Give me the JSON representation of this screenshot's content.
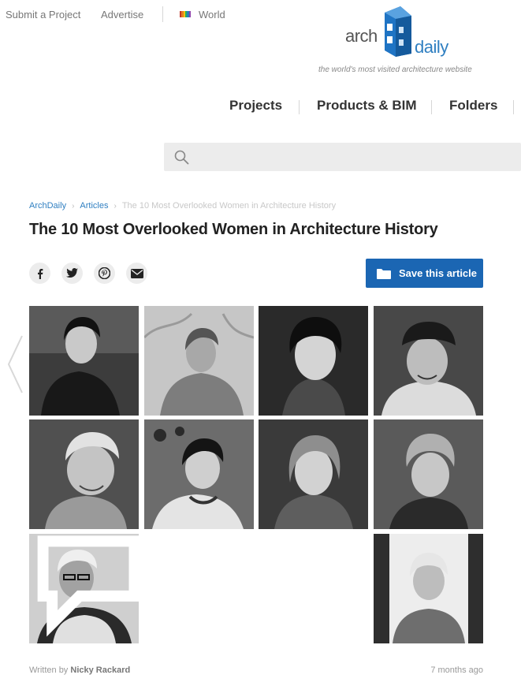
{
  "topbar": {
    "submit_label": "Submit a Project",
    "advertise_label": "Advertise",
    "world_label": "World",
    "world_flag_colors": [
      "#c0392b",
      "#e67e22",
      "#f1c40f",
      "#27ae60",
      "#2980b9",
      "#8e44ad"
    ]
  },
  "logo": {
    "word_arch": "arch",
    "word_daily": "daily",
    "tagline": "the world's most visited architecture website",
    "brand_color": "#2f7fc1"
  },
  "nav": {
    "items": [
      {
        "label": "Projects"
      },
      {
        "label": "Products & BIM"
      },
      {
        "label": "Folders"
      }
    ]
  },
  "search": {
    "placeholder": "",
    "value": ""
  },
  "breadcrumb": {
    "items": [
      {
        "label": "ArchDaily"
      },
      {
        "label": "Articles"
      }
    ],
    "current": "The 10 Most Overlooked Women in Architecture History"
  },
  "article": {
    "title": "The 10 Most Overlooked Women in Architecture History",
    "save_label": "Save this article",
    "share_icons": [
      "facebook-icon",
      "twitter-icon",
      "pinterest-icon",
      "email-icon"
    ],
    "accent_color": "#1b66b3"
  },
  "gallery": {
    "photos": [
      {
        "icon": "portrait-photo"
      },
      {
        "icon": "portrait-photo"
      },
      {
        "icon": "portrait-photo"
      },
      {
        "icon": "portrait-photo"
      },
      {
        "icon": "portrait-photo"
      },
      {
        "icon": "portrait-photo"
      },
      {
        "icon": "portrait-photo"
      },
      {
        "icon": "portrait-photo"
      },
      {
        "icon": "portrait-photo"
      },
      {
        "icon": "portrait-photo"
      }
    ]
  },
  "footer": {
    "written_by_prefix": "Written by",
    "author": "Nicky Rackard",
    "time_ago": "7 months ago"
  }
}
